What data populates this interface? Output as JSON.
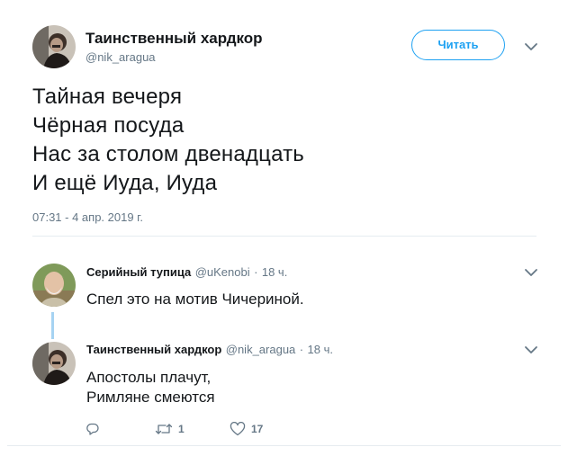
{
  "main_tweet": {
    "author_name": "Таинственный хардкор",
    "author_handle": "@nik_aragua",
    "follow_label": "Читать",
    "lines": [
      "Тайная вечеря",
      "Чёрная посуда",
      "Нас за столом двенадцать",
      "И ещё Иуда, Иуда"
    ],
    "timestamp": "07:31 - 4 апр. 2019 г."
  },
  "replies": [
    {
      "author_name": "Серийный тупица",
      "author_handle": "@uKenobi",
      "time": "18 ч.",
      "text": [
        "Спел это на мотив Чичериной."
      ]
    },
    {
      "author_name": "Таинственный хардкор",
      "author_handle": "@nik_aragua",
      "time": "18 ч.",
      "text": [
        "Апостолы плачут,",
        "Римляне смеются"
      ],
      "actions": {
        "reply_count": "",
        "retweet_count": "1",
        "like_count": "17"
      }
    }
  ],
  "separator": "·",
  "colors": {
    "accent": "#1da1f2",
    "secondary_text": "#657786",
    "thread_line": "#a6d3f2",
    "divider": "#e6ecf0"
  },
  "icons": [
    "chevron-down-icon",
    "reply-icon",
    "retweet-icon",
    "heart-icon"
  ]
}
